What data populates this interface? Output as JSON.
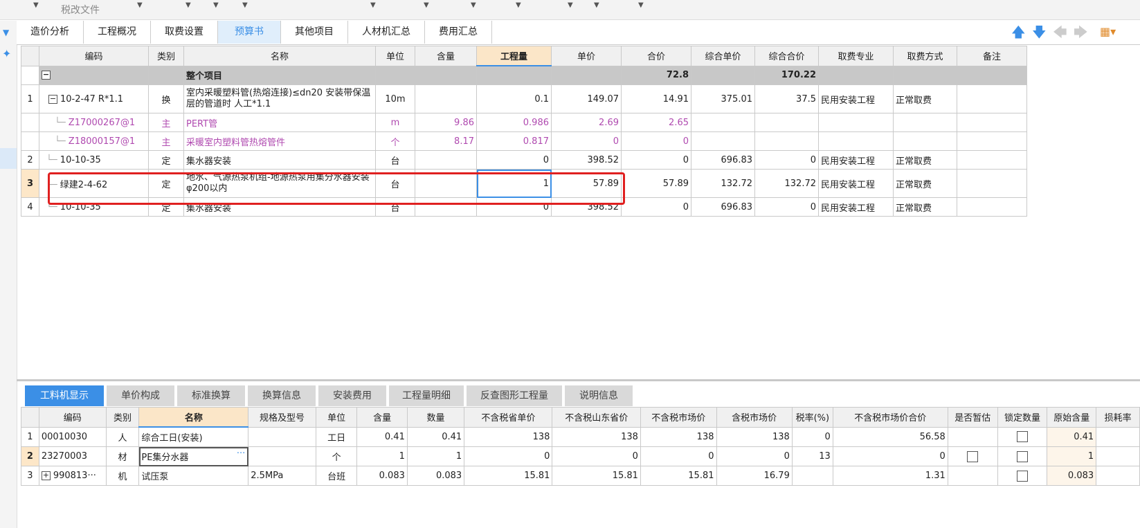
{
  "topbar": {
    "label": "税改文件"
  },
  "main_tabs": [
    "造价分析",
    "工程概况",
    "取费设置",
    "预算书",
    "其他项目",
    "人材机汇总",
    "费用汇总"
  ],
  "active_tab": "预算书",
  "main_table": {
    "headers": [
      "编码",
      "类别",
      "名称",
      "单位",
      "含量",
      "工程量",
      "单价",
      "合价",
      "综合单价",
      "综合合价",
      "取费专业",
      "取费方式",
      "备注"
    ],
    "total_row": {
      "name": "整个项目",
      "hejia": "72.8",
      "zonghe_hejia": "170.22"
    },
    "rows": [
      {
        "no": "1",
        "code": "10-2-47 R*1.1",
        "type": "换",
        "name": "室内采暖塑料管(热熔连接)≤dn20  安装带保温层的管道时 人工*1.1",
        "unit": "10m",
        "hanliang": "",
        "qty": "0.1",
        "price": "149.07",
        "total": "14.91",
        "zprice": "375.01",
        "ztotal": "37.5",
        "zhuanye": "民用安装工程",
        "fangshi": "正常取费",
        "note": ""
      },
      {
        "no": "",
        "code": "Z17000267@1",
        "type": "主",
        "name": "PERT管",
        "unit": "m",
        "hanliang": "9.86",
        "qty": "0.986",
        "price": "2.69",
        "total": "2.65",
        "zprice": "",
        "ztotal": "",
        "zhuanye": "",
        "fangshi": "",
        "note": ""
      },
      {
        "no": "",
        "code": "Z18000157@1",
        "type": "主",
        "name": "采暖室内塑料管热熔管件",
        "unit": "个",
        "hanliang": "8.17",
        "qty": "0.817",
        "price": "0",
        "total": "0",
        "zprice": "",
        "ztotal": "",
        "zhuanye": "",
        "fangshi": "",
        "note": ""
      },
      {
        "no": "2",
        "code": "10-10-35",
        "type": "定",
        "name": "集水器安装",
        "unit": "台",
        "hanliang": "",
        "qty": "0",
        "price": "398.52",
        "total": "0",
        "zprice": "696.83",
        "ztotal": "0",
        "zhuanye": "民用安装工程",
        "fangshi": "正常取费",
        "note": ""
      },
      {
        "no": "3",
        "code": "绿建2-4-62",
        "type": "定",
        "name": "地水、气源热泵机组-地源热泵用集分水器安装 φ200以内",
        "unit": "台",
        "hanliang": "",
        "qty": "1",
        "price": "57.89",
        "total": "57.89",
        "zprice": "132.72",
        "ztotal": "132.72",
        "zhuanye": "民用安装工程",
        "fangshi": "正常取费",
        "note": ""
      },
      {
        "no": "4",
        "code": "10-10-35",
        "type": "定",
        "name": "集水器安装",
        "unit": "台",
        "hanliang": "",
        "qty": "0",
        "price": "398.52",
        "total": "0",
        "zprice": "696.83",
        "ztotal": "0",
        "zhuanye": "民用安装工程",
        "fangshi": "正常取费",
        "note": ""
      }
    ]
  },
  "bottom_tabs": [
    "工料机显示",
    "单价构成",
    "标准换算",
    "换算信息",
    "安装费用",
    "工程量明细",
    "反查图形工程量",
    "说明信息"
  ],
  "bottom_active": "工料机显示",
  "sub_table": {
    "headers": [
      "编码",
      "类别",
      "名称",
      "规格及型号",
      "单位",
      "含量",
      "数量",
      "不含税省单价",
      "不含税山东省价",
      "不含税市场价",
      "含税市场价",
      "税率(%)",
      "不含税市场价合价",
      "是否暂估",
      "锁定数量",
      "原始含量",
      "损耗率"
    ],
    "rows": [
      {
        "no": "1",
        "code": "00010030",
        "type": "人",
        "name": "综合工日(安装)",
        "spec": "",
        "unit": "工日",
        "hanliang": "0.41",
        "qty": "0.41",
        "p1": "138",
        "p2": "138",
        "p3": "138",
        "p4": "138",
        "tax": "0",
        "sum": "56.58",
        "orig": "0.41",
        "loss": ""
      },
      {
        "no": "2",
        "code": "23270003",
        "type": "材",
        "name": "PE集分水器",
        "spec": "",
        "unit": "个",
        "hanliang": "1",
        "qty": "1",
        "p1": "0",
        "p2": "0",
        "p3": "0",
        "p4": "0",
        "tax": "13",
        "sum": "0",
        "orig": "1",
        "loss": ""
      },
      {
        "no": "3",
        "code": "990813···",
        "type": "机",
        "name": "试压泵",
        "spec": "2.5MPa",
        "unit": "台班",
        "hanliang": "0.083",
        "qty": "0.083",
        "p1": "15.81",
        "p2": "15.81",
        "p3": "15.81",
        "p4": "16.79",
        "tax": "",
        "sum": "1.31",
        "orig": "0.083",
        "loss": ""
      }
    ]
  },
  "colors": {
    "accent": "#3b8fe6",
    "highlight_box": "#e02020",
    "sub_item_text": "#b04ab0"
  },
  "toolbar_icons": [
    "arrow-up-icon",
    "arrow-down-icon",
    "arrow-left-icon",
    "arrow-right-icon",
    "column-settings-icon"
  ]
}
